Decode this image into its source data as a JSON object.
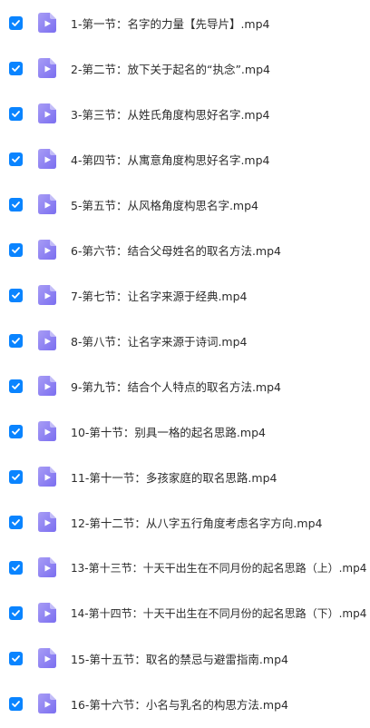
{
  "colors": {
    "checkbox": "#0a84ff",
    "file_icon_gradient_start": "#a79cf5",
    "file_icon_gradient_end": "#7b6ef0",
    "text": "#2c2c2c"
  },
  "icons": {
    "checkbox": "checkmark-icon",
    "file": "video-file-icon"
  },
  "files": [
    {
      "name": "1-第一节：名字的力量【先导片】.mp4",
      "checked": true
    },
    {
      "name": "2-第二节：放下关于起名的“执念”.mp4",
      "checked": true
    },
    {
      "name": "3-第三节：从姓氏角度构思好名字.mp4",
      "checked": true
    },
    {
      "name": "4-第四节：从寓意角度构思好名字.mp4",
      "checked": true
    },
    {
      "name": "5-第五节：从风格角度构思名字.mp4",
      "checked": true
    },
    {
      "name": "6-第六节：结合父母姓名的取名方法.mp4",
      "checked": true
    },
    {
      "name": "7-第七节：让名字来源于经典.mp4",
      "checked": true
    },
    {
      "name": "8-第八节：让名字来源于诗词.mp4",
      "checked": true
    },
    {
      "name": "9-第九节：结合个人特点的取名方法.mp4",
      "checked": true
    },
    {
      "name": "10-第十节：别具一格的起名思路.mp4",
      "checked": true
    },
    {
      "name": "11-第十一节：多孩家庭的取名思路.mp4",
      "checked": true
    },
    {
      "name": "12-第十二节：从八字五行角度考虑名字方向.mp4",
      "checked": true
    },
    {
      "name": "13-第十三节：十天干出生在不同月份的起名思路（上）.mp4",
      "checked": true
    },
    {
      "name": "14-第十四节：十天干出生在不同月份的起名思路（下）.mp4",
      "checked": true
    },
    {
      "name": "15-第十五节：取名的禁忌与避雷指南.mp4",
      "checked": true
    },
    {
      "name": "16-第十六节：小名与乳名的构思方法.mp4",
      "checked": true
    }
  ]
}
